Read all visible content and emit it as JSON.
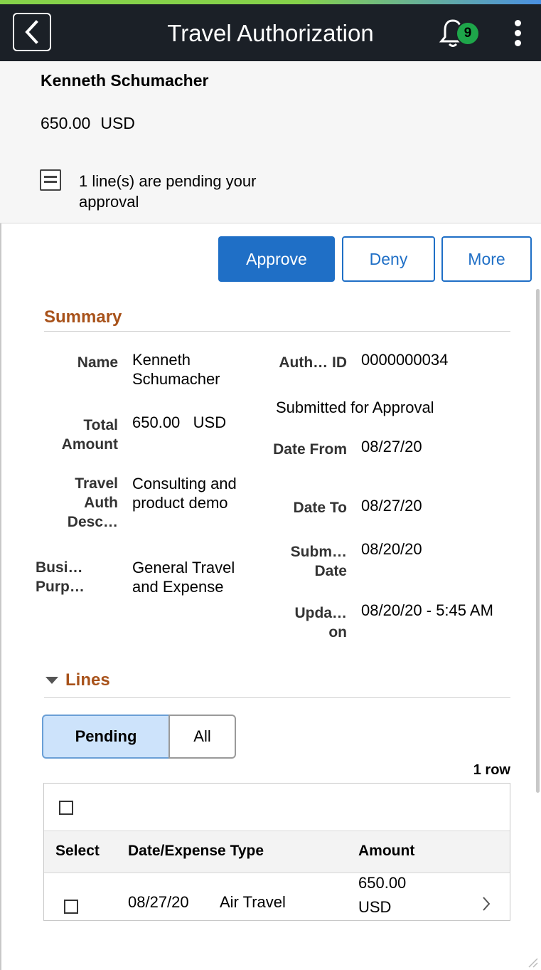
{
  "header": {
    "title": "Travel Authorization",
    "notification_count": "9",
    "back_icon": "chevron-left-icon",
    "bell_icon": "bell-icon",
    "menu_icon": "kebab-menu-icon"
  },
  "banner": {
    "employee_name": "Kenneth Schumacher",
    "amount": "650.00",
    "currency": "USD",
    "pending_text": "1 line(s) are pending your approval"
  },
  "actions": {
    "approve": "Approve",
    "deny": "Deny",
    "more": "More"
  },
  "summary": {
    "title": "Summary",
    "name_label": "Name",
    "name_value": "Kenneth Schumacher",
    "total_label": "Total Amount",
    "total_amount": "650.00",
    "total_currency": "USD",
    "desc_label": "Travel Auth Desc…",
    "desc_value": "Consulting and product demo",
    "purpose_label": "Busi… Purp…",
    "purpose_value": "General Travel and Expense",
    "auth_id_label": "Auth… ID",
    "auth_id_value": "0000000034",
    "status_value": "Submitted for Approval",
    "date_from_label": "Date From",
    "date_from_value": "08/27/20",
    "date_to_label": "Date To",
    "date_to_value": "08/27/20",
    "submitted_label": "Subm… Date",
    "submitted_value": "08/20/20",
    "updated_label": "Upda… on",
    "updated_value": "08/20/20 - 5:45 AM"
  },
  "lines": {
    "title": "Lines",
    "tabs": [
      "Pending",
      "All"
    ],
    "row_count": "1 row",
    "columns": [
      "Select",
      "Date/Expense Type",
      "Amount"
    ],
    "rows": [
      {
        "date": "08/27/20",
        "expense_type": "Air Travel",
        "amount": "650.00",
        "currency": "USD"
      }
    ]
  },
  "colors": {
    "header_bg": "#1b2027",
    "primary": "#1f6fc6",
    "section_title": "#a8521a",
    "badge": "#1ea64a"
  }
}
